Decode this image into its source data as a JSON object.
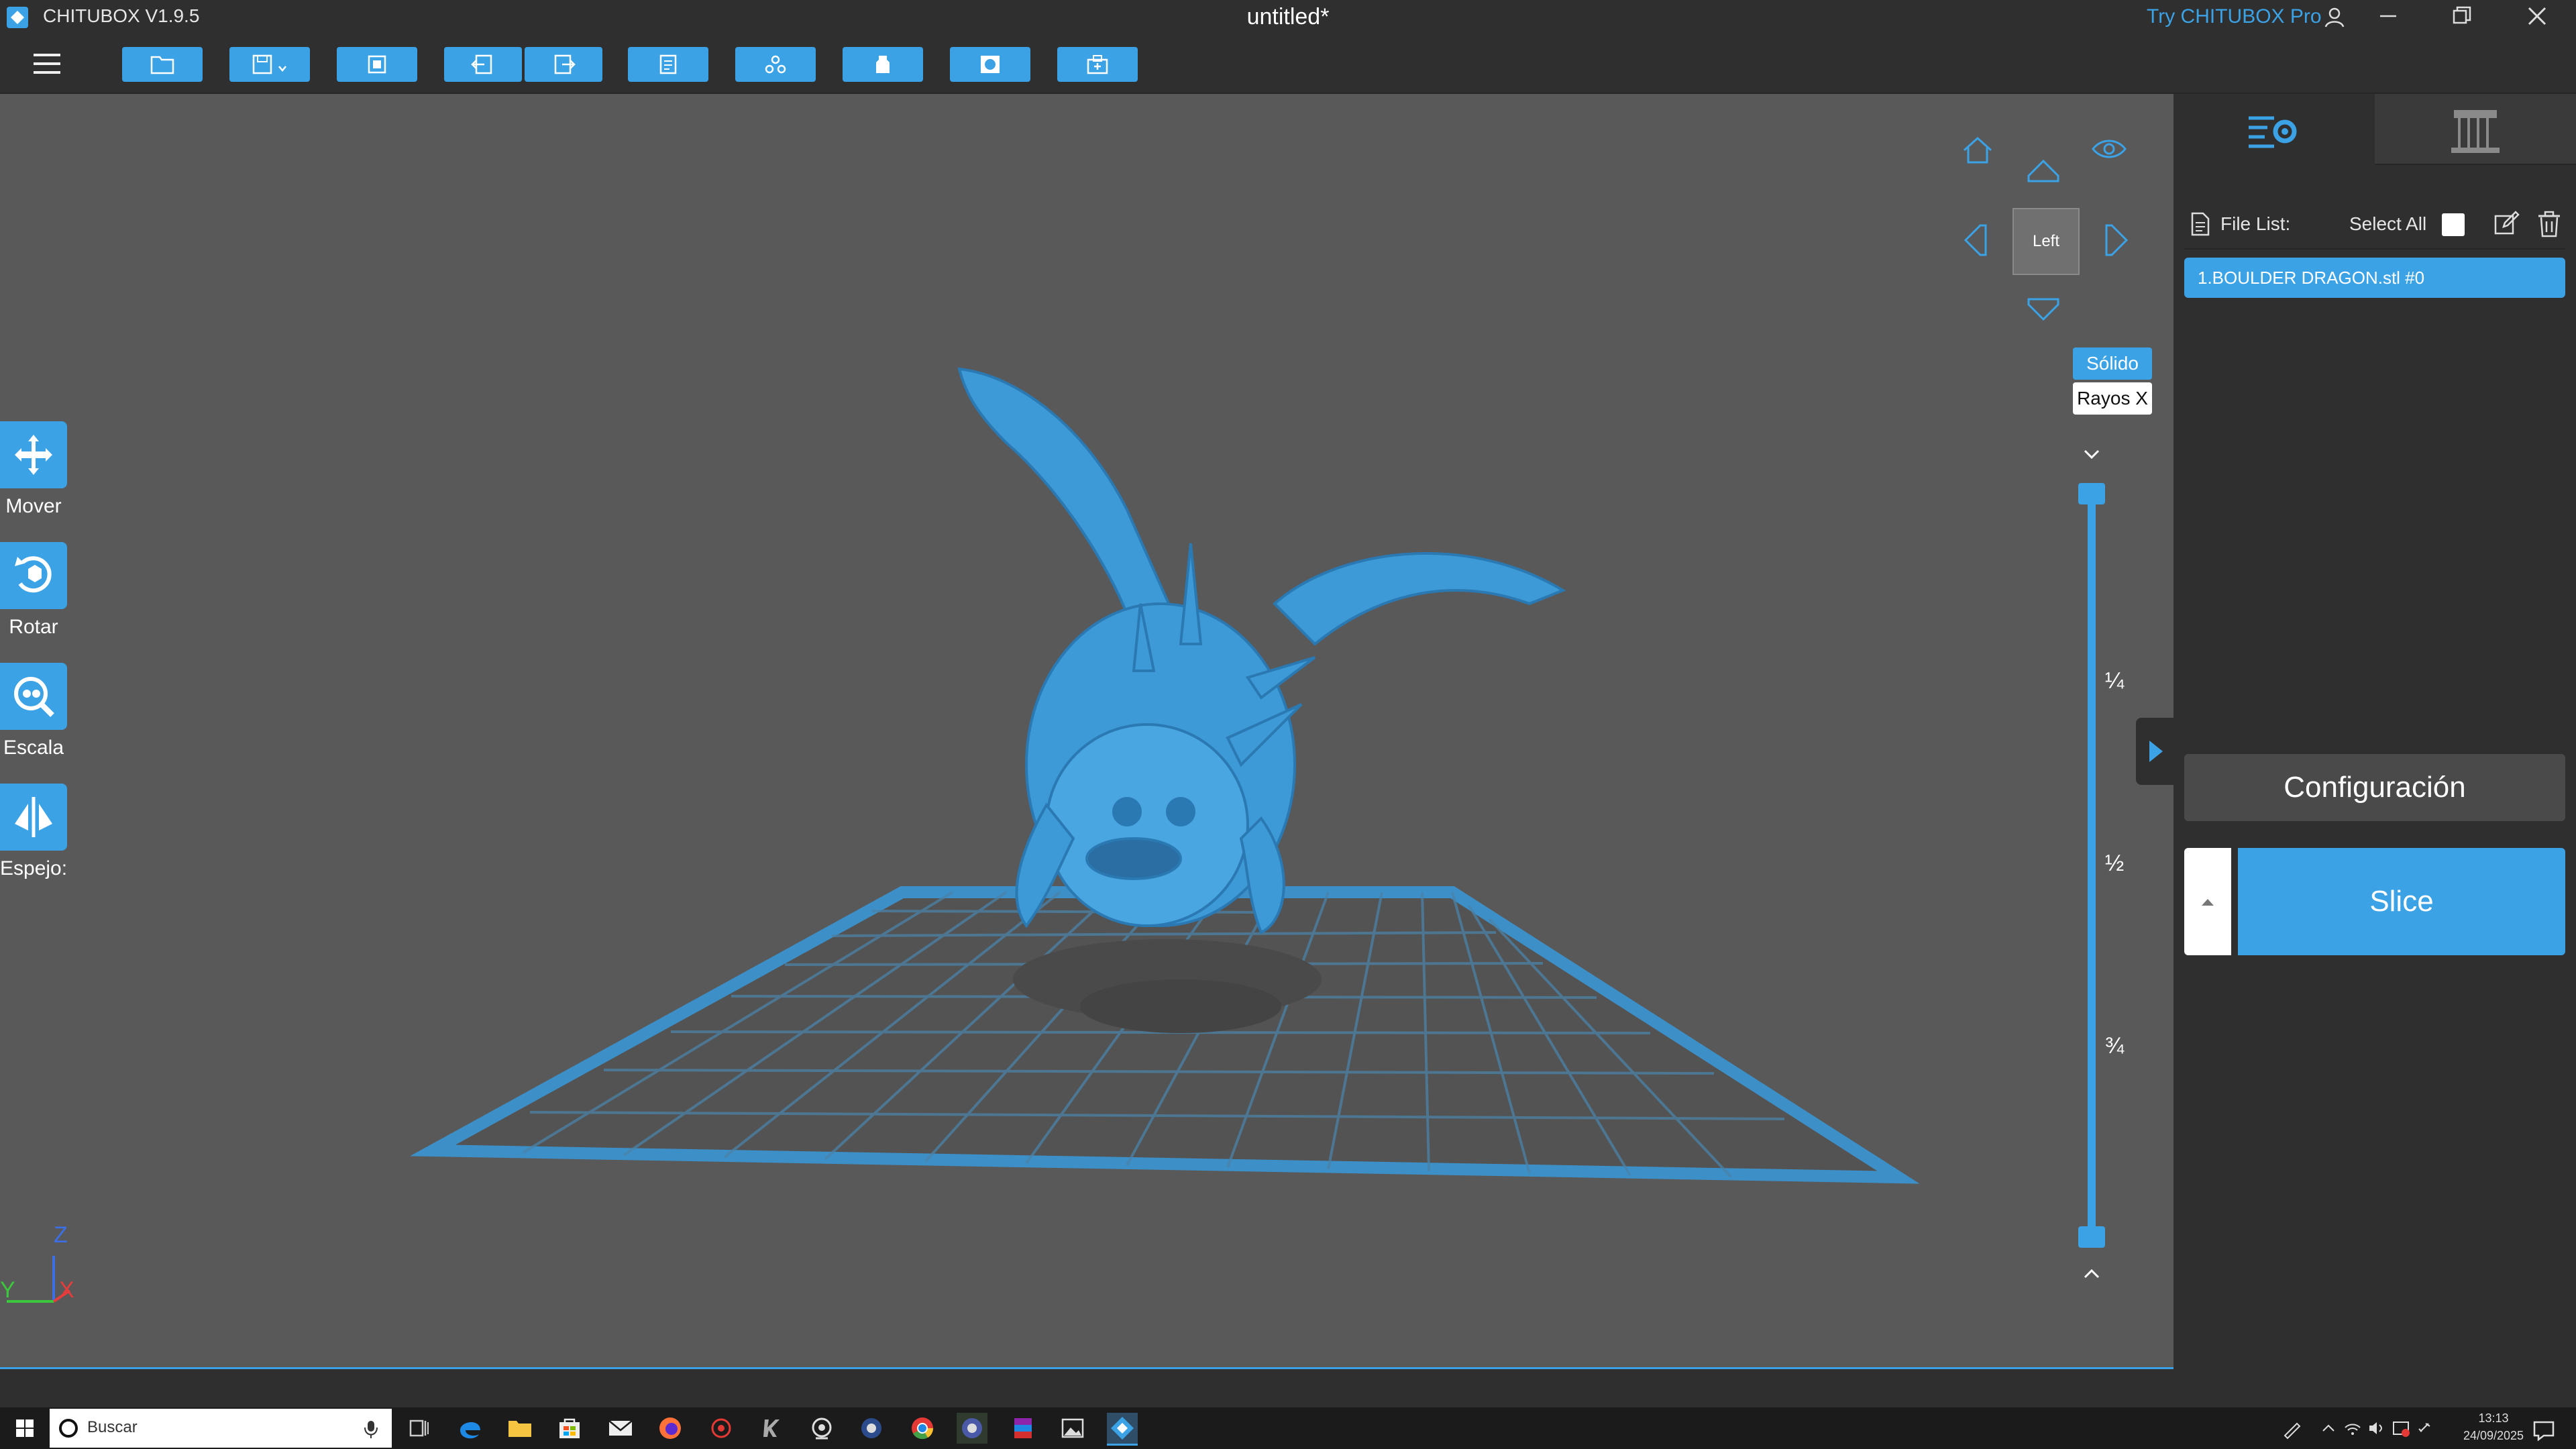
{
  "app": {
    "name": "CHITUBOX V1.9.5",
    "document_title": "untitled*",
    "try_pro": "Try CHITUBOX Pro",
    "accent_color": "#3ca2e6"
  },
  "left_tools": [
    {
      "label": "Mover",
      "icon": "move-icon"
    },
    {
      "label": "Rotar",
      "icon": "rotate-icon"
    },
    {
      "label": "Escala",
      "icon": "scale-icon"
    },
    {
      "label": "Espejo:",
      "icon": "mirror-icon"
    }
  ],
  "view": {
    "current": "Left",
    "modes": {
      "solid": "Sólido",
      "xray": "Rayos X"
    },
    "active_mode": "solid"
  },
  "layer_slider": {
    "marks": [
      "¼",
      "½",
      "¾"
    ],
    "top_value": 1.0,
    "bottom_value": 0.0
  },
  "axes": {
    "z": "Z",
    "y": "Y",
    "x": "X"
  },
  "right_panel": {
    "file_list_label": "File List:",
    "select_all_label": "Select All",
    "files": [
      "1.BOULDER DRAGON.stl #0"
    ],
    "config_label": "Configuración",
    "slice_label": "Slice"
  },
  "taskbar": {
    "search_placeholder": "Buscar",
    "time": "13:13",
    "date": "24/09/2025"
  }
}
